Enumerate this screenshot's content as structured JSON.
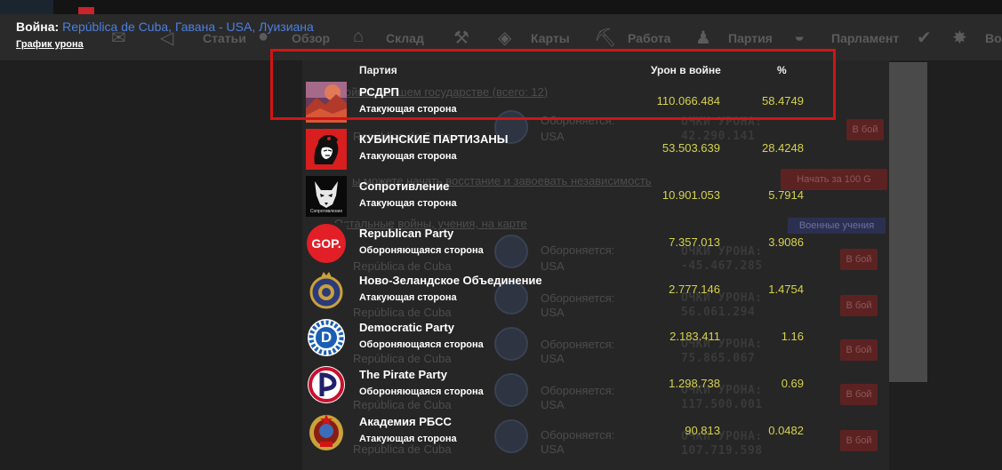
{
  "header": {
    "war_label": "Война:",
    "war_link": "República de Cuba, Гавана - USA, Луизиана",
    "damage_graph_link": "График урона"
  },
  "background": {
    "nav": [
      "Статьи",
      "Обзор",
      "Склад",
      "Карты",
      "Работа",
      "Партия",
      "Парламент",
      "Во"
    ],
    "wars_heading": "ойны в вашем государстве (всего: 12)",
    "uprising_text": "ы можете начать восстание и завоевать независимость",
    "other_wars": "Остальные войны, учения, на карте",
    "defender_label": "Обороняется:",
    "defender_value": "USA",
    "republica": "República de Cuba",
    "score_label": "ОЧКИ УРОНА:",
    "scores": [
      "42.290.141",
      "-45.467.285",
      "56.061.294",
      "75.865.067",
      "117.500.001",
      "107.719.598"
    ],
    "fight_button": "В бой",
    "start_uprising_button": "Начать за 100 G",
    "military_exercise_button": "Военные учения"
  },
  "table": {
    "col_party": "Партия",
    "col_damage": "Урон в войне",
    "col_percent": "%",
    "rows": [
      {
        "name": "РСДРП",
        "side": "Атакующая сторона",
        "damage": "110.066.484",
        "percent": "58.4749",
        "logo": "red-landscape-logo"
      },
      {
        "name": "КУБИНСКИЕ ПАРТИЗАНЫ",
        "side": "Атакующая сторона",
        "damage": "53.503.639",
        "percent": "28.4248",
        "logo": "che-guevara-logo"
      },
      {
        "name": "Сопротивление",
        "side": "Атакующая сторона",
        "damage": "10.901.053",
        "percent": "5.7914",
        "logo": "wolf-logo",
        "logo_caption": "Сопротивление"
      },
      {
        "name": "Republican Party",
        "side": "Обороняющаяся сторона",
        "damage": "7.357.013",
        "percent": "3.9086",
        "logo": "gop-logo",
        "logo_text": "GOP."
      },
      {
        "name": "Ново-Зеландское Объединение",
        "side": "Атакующая сторона",
        "damage": "2.777.146",
        "percent": "1.4754",
        "logo": "crest-logo"
      },
      {
        "name": "Democratic Party",
        "side": "Обороняющаяся сторона",
        "damage": "2.183.411",
        "percent": "1.16",
        "logo": "democratic-logo",
        "logo_text": "D"
      },
      {
        "name": "The Pirate Party",
        "side": "Обороняющаяся сторона",
        "damage": "1.298.738",
        "percent": "0.69",
        "logo": "pirate-party-logo"
      },
      {
        "name": "Академия РБСС",
        "side": "Атакующая сторона",
        "damage": "90.813",
        "percent": "0.0482",
        "logo": "soviet-emblem-logo"
      }
    ]
  },
  "colors": {
    "highlight": "#d21414",
    "value": "#d6d24e",
    "link": "#4d7fe0"
  }
}
